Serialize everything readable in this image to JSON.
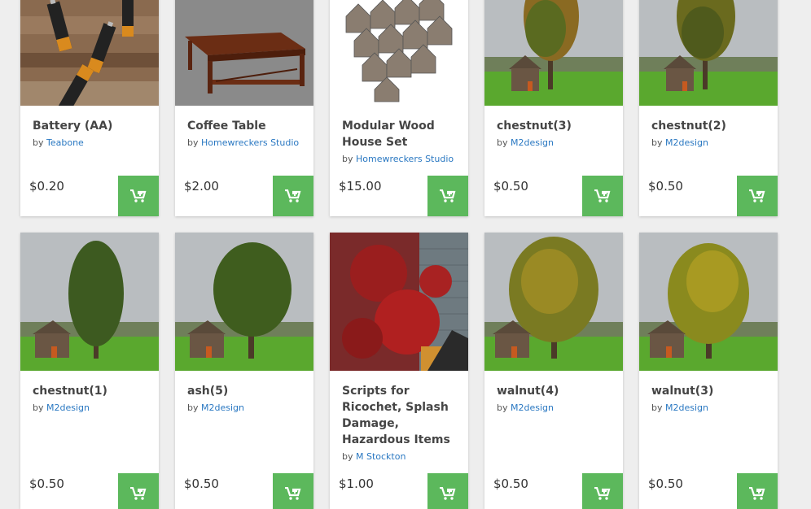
{
  "colors": {
    "accent_green": "#5cb85c",
    "link_blue": "#2a78c2",
    "background": "#eeeeee"
  },
  "products": [
    {
      "title": "Battery (AA)",
      "by_prefix": "by",
      "author": "Teabone",
      "price": "$0.20",
      "thumbnail": "batteries-on-wood",
      "cart_icon": "add-to-cart-icon"
    },
    {
      "title": "Coffee Table",
      "by_prefix": "by",
      "author": "Homewreckers Studio",
      "price": "$2.00",
      "thumbnail": "wooden-coffee-table",
      "cart_icon": "add-to-cart-icon"
    },
    {
      "title": "Modular Wood House Set",
      "by_prefix": "by",
      "author": "Homewreckers Studio",
      "price": "$15.00",
      "thumbnail": "wooden-houses",
      "cart_icon": "add-to-cart-icon"
    },
    {
      "title": "chestnut(3)",
      "by_prefix": "by",
      "author": "M2design",
      "price": "$0.50",
      "thumbnail": "tree-with-cabin",
      "cart_icon": "add-to-cart-icon"
    },
    {
      "title": "chestnut(2)",
      "by_prefix": "by",
      "author": "M2design",
      "price": "$0.50",
      "thumbnail": "tree-with-cabin",
      "cart_icon": "add-to-cart-icon"
    },
    {
      "title": "chestnut(1)",
      "by_prefix": "by",
      "author": "M2design",
      "price": "$0.50",
      "thumbnail": "tree-with-cabin",
      "cart_icon": "add-to-cart-icon"
    },
    {
      "title": "ash(5)",
      "by_prefix": "by",
      "author": "M2design",
      "price": "$0.50",
      "thumbnail": "tree-with-cabin",
      "cart_icon": "add-to-cart-icon"
    },
    {
      "title": "Scripts for Ricochet, Splash Damage, Hazardous Items",
      "by_prefix": "by",
      "author": "M Stockton",
      "price": "$1.00",
      "thumbnail": "blood-splatter-wall",
      "cart_icon": "add-to-cart-icon"
    },
    {
      "title": "walnut(4)",
      "by_prefix": "by",
      "author": "M2design",
      "price": "$0.50",
      "thumbnail": "tree-with-cabin",
      "cart_icon": "add-to-cart-icon"
    },
    {
      "title": "walnut(3)",
      "by_prefix": "by",
      "author": "M2design",
      "price": "$0.50",
      "thumbnail": "tree-with-cabin",
      "cart_icon": "add-to-cart-icon"
    }
  ]
}
